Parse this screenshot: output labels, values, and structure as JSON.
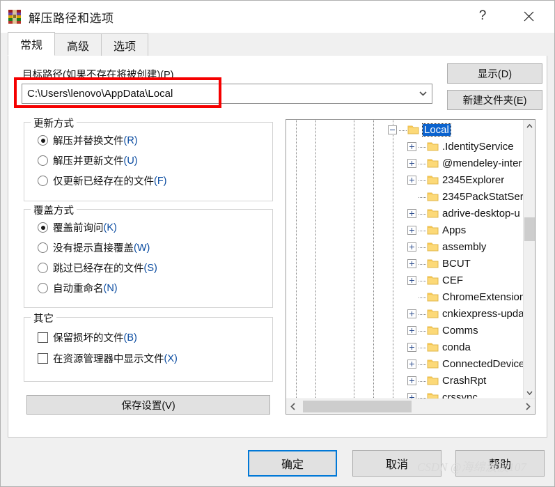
{
  "window": {
    "title": "解压路径和选项",
    "icon": "winrar-books-icon",
    "help_button": "?",
    "close_button": "✕"
  },
  "tabs": [
    {
      "label": "常规",
      "active": true
    },
    {
      "label": "高级",
      "active": false
    },
    {
      "label": "选项",
      "active": false
    }
  ],
  "path_section": {
    "label": "目标路径(如果不存在将被创建)(P)",
    "value": "C:\\Users\\lenovo\\AppData\\Local",
    "placeholder": "",
    "dropdown_icon": "chevron-down-icon",
    "highlight_color": "#f50000"
  },
  "side_buttons": [
    {
      "label": "显示(D)"
    },
    {
      "label": "新建文件夹(E)"
    }
  ],
  "groups": {
    "update": {
      "legend": "更新方式",
      "options": [
        {
          "text": "解压并替换文件",
          "hotkey": "(R)",
          "selected": true
        },
        {
          "text": "解压并更新文件",
          "hotkey": "(U)",
          "selected": false
        },
        {
          "text": "仅更新已经存在的文件",
          "hotkey": "(F)",
          "selected": false
        }
      ]
    },
    "overwrite": {
      "legend": "覆盖方式",
      "options": [
        {
          "text": "覆盖前询问",
          "hotkey": "(K)",
          "selected": true
        },
        {
          "text": "没有提示直接覆盖",
          "hotkey": "(W)",
          "selected": false
        },
        {
          "text": "跳过已经存在的文件",
          "hotkey": "(S)",
          "selected": false
        },
        {
          "text": "自动重命名",
          "hotkey": "(N)",
          "selected": false
        }
      ]
    },
    "other": {
      "legend": "其它",
      "options": [
        {
          "text": "保留损坏的文件",
          "hotkey": "(B)",
          "checked": false
        },
        {
          "text": "在资源管理器中显示文件",
          "hotkey": "(X)",
          "checked": false
        }
      ]
    }
  },
  "save_button": {
    "label": "保存设置(V)"
  },
  "tree": {
    "scroll_up_icon": "chevron-up-icon",
    "scroll_down_icon": "chevron-down-icon",
    "scroll_left_icon": "chevron-left-icon",
    "scroll_right_icon": "chevron-right-icon",
    "items": [
      {
        "label": "Local",
        "depth": 0,
        "toggle": "minus",
        "selected": true
      },
      {
        "label": ".IdentityService",
        "depth": 1,
        "toggle": "plus",
        "selected": false
      },
      {
        "label": "@mendeley-inter",
        "depth": 1,
        "toggle": "plus",
        "selected": false
      },
      {
        "label": "2345Explorer",
        "depth": 1,
        "toggle": "plus",
        "selected": false
      },
      {
        "label": "2345PackStatSer",
        "depth": 1,
        "toggle": "none",
        "selected": false
      },
      {
        "label": "adrive-desktop-u",
        "depth": 1,
        "toggle": "plus",
        "selected": false
      },
      {
        "label": "Apps",
        "depth": 1,
        "toggle": "plus",
        "selected": false
      },
      {
        "label": "assembly",
        "depth": 1,
        "toggle": "plus",
        "selected": false
      },
      {
        "label": "BCUT",
        "depth": 1,
        "toggle": "plus",
        "selected": false
      },
      {
        "label": "CEF",
        "depth": 1,
        "toggle": "plus",
        "selected": false
      },
      {
        "label": "ChromeExtension",
        "depth": 1,
        "toggle": "none",
        "selected": false
      },
      {
        "label": "cnkiexpress-upda",
        "depth": 1,
        "toggle": "plus",
        "selected": false
      },
      {
        "label": "Comms",
        "depth": 1,
        "toggle": "plus",
        "selected": false
      },
      {
        "label": "conda",
        "depth": 1,
        "toggle": "plus",
        "selected": false
      },
      {
        "label": "ConnectedDevice",
        "depth": 1,
        "toggle": "plus",
        "selected": false
      },
      {
        "label": "CrashRpt",
        "depth": 1,
        "toggle": "plus",
        "selected": false
      },
      {
        "label": "crssync",
        "depth": 1,
        "toggle": "plus",
        "selected": false
      }
    ]
  },
  "bottom_buttons": [
    {
      "label": "确定",
      "default": true
    },
    {
      "label": "取消",
      "default": false
    },
    {
      "label": "帮助",
      "default": false
    }
  ],
  "watermark": "CSDN @海绵波波107"
}
